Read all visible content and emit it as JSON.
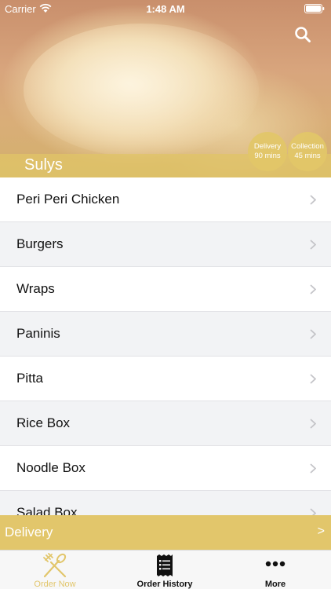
{
  "status_bar": {
    "carrier": "Carrier",
    "time": "1:48 AM"
  },
  "header": {
    "restaurant_name": "Sulys",
    "delivery_badge": {
      "title": "Delivery",
      "value": "90 mins"
    },
    "collection_badge": {
      "title": "Collection",
      "value": "45 mins"
    }
  },
  "menu": {
    "categories": [
      {
        "label": "Peri Peri Chicken"
      },
      {
        "label": "Burgers"
      },
      {
        "label": "Wraps"
      },
      {
        "label": "Paninis"
      },
      {
        "label": "Pitta"
      },
      {
        "label": "Rice Box"
      },
      {
        "label": "Noodle Box"
      },
      {
        "label": "Salad Box"
      }
    ]
  },
  "delivery_bar": {
    "label": "Delivery",
    "arrow": ">"
  },
  "tab_bar": {
    "order_now": "Order Now",
    "order_history": "Order History",
    "more": "More"
  },
  "colors": {
    "accent": "#e2c66b",
    "list_alt": "#f2f3f5",
    "text": "#111111"
  },
  "icons": [
    "wifi-icon",
    "battery-icon",
    "search-icon",
    "chevron-right-icon",
    "fork-knife-icon",
    "receipt-icon",
    "more-dots-icon"
  ]
}
